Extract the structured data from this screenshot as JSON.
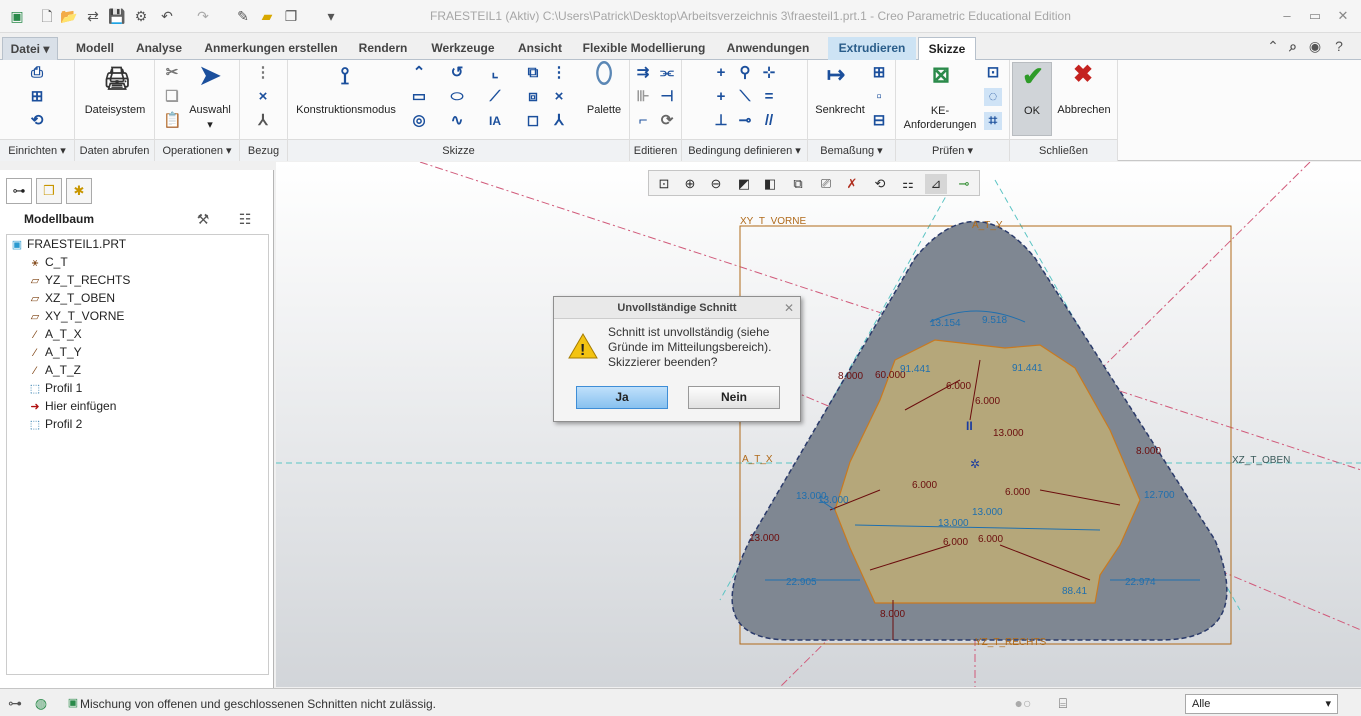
{
  "window": {
    "title": "FRAESTEIL1 (Aktiv) C:\\Users\\Patrick\\Desktop\\Arbeitsverzeichnis 3\\fraesteil1.prt.1 - Creo Parametric Educational Edition"
  },
  "tabs": [
    "Datei",
    "Modell",
    "Analyse",
    "Anmerkungen erstellen",
    "Rendern",
    "Werkzeuge",
    "Ansicht",
    "Flexible Modellierung",
    "Anwendungen",
    "Extrudieren",
    "Skizze"
  ],
  "ribbon": {
    "dateisystem": "Dateisystem",
    "auswahl": "Auswahl",
    "konstruktionsmodus": "Konstruktionsmodus",
    "palette": "Palette",
    "senkrecht": "Senkrecht",
    "ke_anforderungen_1": "KE-",
    "ke_anforderungen_2": "Anforderungen",
    "ok": "OK",
    "abbrechen": "Abbrechen",
    "groups": {
      "einrichten": "Einrichten",
      "daten_abrufen": "Daten abrufen",
      "operationen": "Operationen",
      "bezug": "Bezug",
      "skizze": "Skizze",
      "editieren": "Editieren",
      "bedingung": "Bedingung definieren",
      "bemassung": "Bemaßung",
      "pruefen": "Prüfen",
      "schliessen": "Schließen"
    }
  },
  "modelltree": {
    "header": "Modellbaum",
    "items": [
      {
        "label": "FRAESTEIL1.PRT",
        "icon": "part-icon"
      },
      {
        "label": "C_T",
        "icon": "csys-icon"
      },
      {
        "label": "YZ_T_RECHTS",
        "icon": "datum-plane-icon"
      },
      {
        "label": "XZ_T_OBEN",
        "icon": "datum-plane-icon"
      },
      {
        "label": "XY_T_VORNE",
        "icon": "datum-plane-icon"
      },
      {
        "label": "A_T_X",
        "icon": "axis-icon"
      },
      {
        "label": "A_T_Y",
        "icon": "axis-icon"
      },
      {
        "label": "A_T_Z",
        "icon": "axis-icon"
      },
      {
        "label": "Profil 1",
        "icon": "profile-icon"
      },
      {
        "label": "Hier einfügen",
        "icon": "insert-arrow-icon"
      },
      {
        "label": "Profil 2",
        "icon": "profile-new-icon"
      }
    ]
  },
  "sketch": {
    "plane_labels": {
      "xy": "XY_T_VORNE",
      "at_y": "A_T_Y",
      "at_x": "A_T_X",
      "xz": "XZ_T_OBEN",
      "yz": "YZ_T_RECHTS"
    },
    "dims": [
      "13.154",
      "9.518",
      "8.000",
      "60.000",
      "6.000",
      "6.000",
      "13.000",
      "8.000",
      "91.441",
      "91.441",
      "6.000",
      "6.000",
      "13.000",
      "13.000",
      "12.700",
      "13.000",
      "6.000",
      "6.000",
      "13.000",
      "22.905",
      "22.974",
      "88.41",
      "8.000",
      "13.000"
    ]
  },
  "dialog": {
    "title": "Unvollständige Schnitt",
    "message": "Schnitt ist unvollständig (siehe Gründe im Mitteilungsbereich). Skizzierer beenden?",
    "yes": "Ja",
    "no": "Nein"
  },
  "status": {
    "message": "Mischung von offenen und geschlossenen Schnitten nicht zulässig.",
    "filter": "Alle"
  },
  "colors": {
    "accent": "#2a6fb0",
    "ok_green": "#2e9b28",
    "cancel_red": "#c4221f",
    "sketch_orange": "#b06a1a",
    "part_gray": "#7f8792"
  }
}
